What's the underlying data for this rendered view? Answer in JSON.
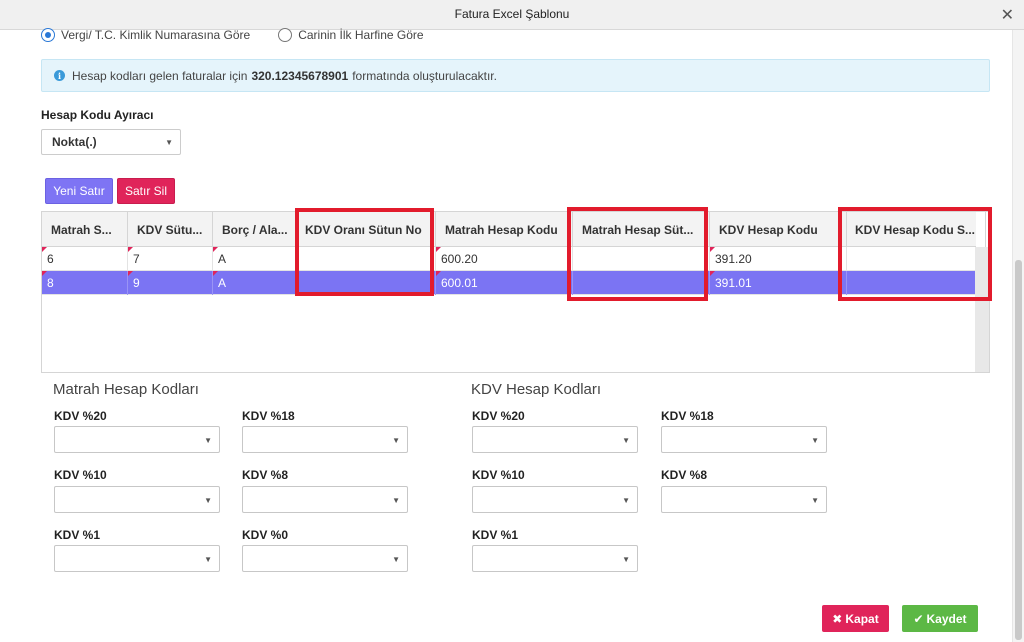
{
  "window": {
    "title": "Fatura Excel Şablonu",
    "close_glyph": "✕"
  },
  "radio_options": [
    {
      "label": "Vergi/ T.C. Kimlik Numarasına Göre",
      "selected": true
    },
    {
      "label": "Carinin İlk Harfine Göre",
      "selected": false
    }
  ],
  "info": {
    "prefix": "Hesap kodları gelen faturalar için",
    "code": "320.12345678901",
    "suffix": "formatında oluşturulacaktır.",
    "icon": "info-icon"
  },
  "separator": {
    "label": "Hesap Kodu Ayıracı",
    "value": "Nokta(.)"
  },
  "grid_buttons": {
    "new_row": "Yeni Satır",
    "delete_row": "Satır Sil"
  },
  "grid": {
    "columns": [
      "Matrah S...",
      "KDV Sütu...",
      "Borç / Ala...",
      "KDV Oranı Sütun No",
      "Matrah Hesap Kodu",
      "Matrah Hesap Süt...",
      "KDV Hesap Kodu",
      "KDV Hesap Kodu S..."
    ],
    "rows": [
      {
        "cells": [
          "6",
          "7",
          "A",
          "",
          "600.20",
          "",
          "391.20",
          ""
        ],
        "selected": false
      },
      {
        "cells": [
          "8",
          "9",
          "A",
          "",
          "600.01",
          "",
          "391.01",
          ""
        ],
        "selected": true
      }
    ]
  },
  "matrah": {
    "title": "Matrah Hesap Kodları",
    "fields": [
      {
        "label": "KDV %20",
        "value": ""
      },
      {
        "label": "KDV %18",
        "value": ""
      },
      {
        "label": "KDV %10",
        "value": ""
      },
      {
        "label": "KDV %8",
        "value": ""
      },
      {
        "label": "KDV %1",
        "value": ""
      },
      {
        "label": "KDV %0",
        "value": ""
      }
    ]
  },
  "kdv": {
    "title": "KDV Hesap Kodları",
    "fields": [
      {
        "label": "KDV %20",
        "value": ""
      },
      {
        "label": "KDV %18",
        "value": ""
      },
      {
        "label": "KDV %10",
        "value": ""
      },
      {
        "label": "KDV %8",
        "value": ""
      },
      {
        "label": "KDV %1",
        "value": ""
      }
    ]
  },
  "footer": {
    "close_label": "Kapat",
    "save_label": "Kaydet",
    "close_icon": "✖",
    "save_icon": "✔"
  },
  "colors": {
    "accent": "#7b74f3",
    "danger": "#e0245a",
    "success": "#5cb845",
    "highlight": "#e21b2c"
  }
}
